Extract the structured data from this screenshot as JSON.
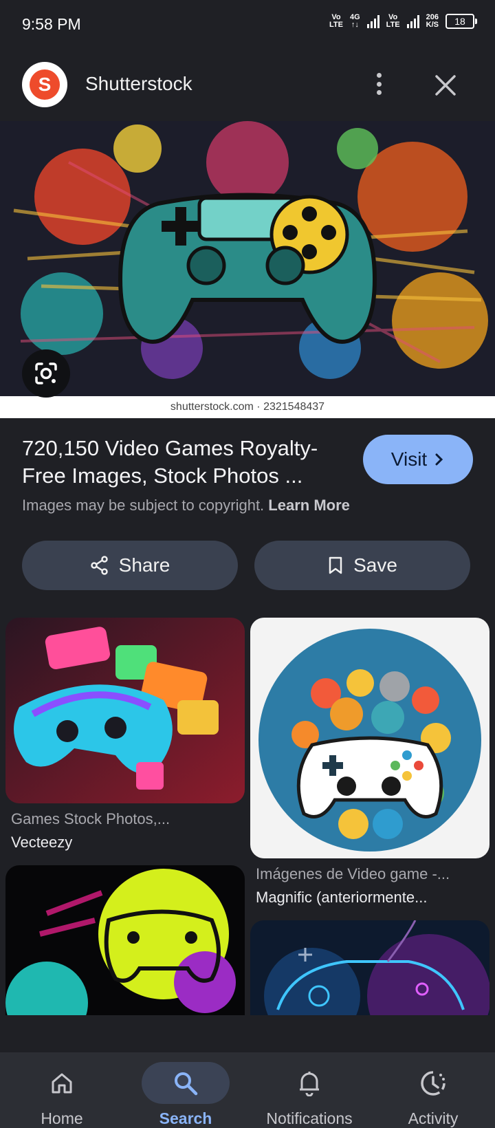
{
  "status_bar": {
    "time": "9:58 PM",
    "volte1_top": "Vo",
    "volte1_bottom": "LTE",
    "net_top": "4G",
    "net_bottom": "↑↓",
    "volte2_top": "Vo",
    "volte2_bottom": "LTE",
    "speed_top": "206",
    "speed_bottom": "K/S",
    "battery": "18"
  },
  "header": {
    "site_name": "Shutterstock",
    "logo_letter": "S"
  },
  "hero": {
    "watermark": "shutterstock.com · 2321548437"
  },
  "result": {
    "title": "720,150 Video Games Royalty-Free Images, Stock Photos ...",
    "visit_label": "Visit",
    "copyright_text": "Images may be subject to copyright.",
    "learn_more": "Learn More"
  },
  "actions": {
    "share_label": "Share",
    "save_label": "Save"
  },
  "related": [
    {
      "title": "Games Stock Photos,...",
      "source": "Vecteezy"
    },
    {
      "title": "Imágenes de Video game -...",
      "source": "Magnific (anteriormente..."
    }
  ],
  "nav": {
    "home": "Home",
    "search": "Search",
    "notifications": "Notifications",
    "activity": "Activity"
  },
  "colors": {
    "background": "#1f2025",
    "accent": "#8ab4f8",
    "pill": "#3a4150"
  }
}
